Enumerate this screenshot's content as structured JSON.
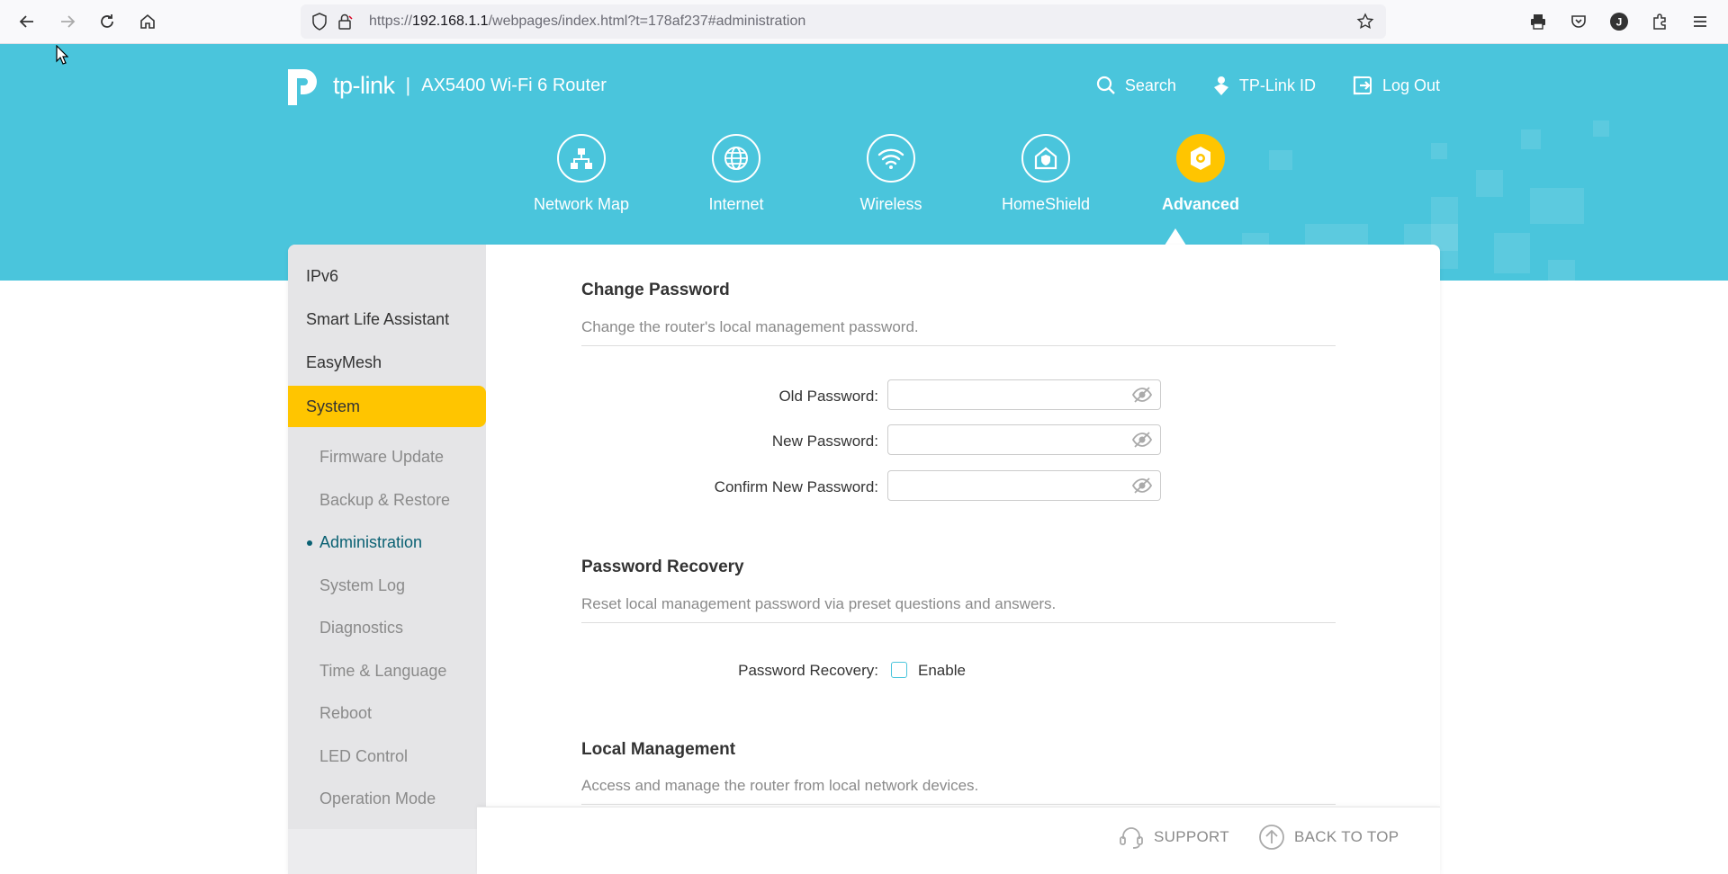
{
  "browser": {
    "url_prefix": "https://",
    "url_host": "192.168.1.1",
    "url_rest": "/webpages/index.html?t=178af237#administration"
  },
  "header": {
    "brand": "tp-link",
    "model": "AX5400 Wi-Fi 6 Router",
    "links": [
      {
        "label": "Search",
        "icon": "search-icon"
      },
      {
        "label": "TP-Link ID",
        "icon": "tplink-id-icon"
      },
      {
        "label": "Log Out",
        "icon": "logout-icon"
      }
    ]
  },
  "nav": [
    {
      "label": "Network Map",
      "icon": "network-map-icon",
      "active": false
    },
    {
      "label": "Internet",
      "icon": "globe-icon",
      "active": false
    },
    {
      "label": "Wireless",
      "icon": "wifi-icon",
      "active": false
    },
    {
      "label": "HomeShield",
      "icon": "homeshield-icon",
      "active": false
    },
    {
      "label": "Advanced",
      "icon": "gear-icon",
      "active": true
    }
  ],
  "sidebar": {
    "top_items": [
      "IPv6",
      "Smart Life Assistant",
      "EasyMesh"
    ],
    "active_section": "System",
    "sub_items": [
      "Firmware Update",
      "Backup & Restore",
      "Administration",
      "System Log",
      "Diagnostics",
      "Time & Language",
      "Reboot",
      "LED Control",
      "Operation Mode"
    ],
    "current_sub": "Administration"
  },
  "sections": {
    "change_password": {
      "title": "Change Password",
      "desc": "Change the router's local management password.",
      "old_label": "Old Password:",
      "new_label": "New Password:",
      "confirm_label": "Confirm New Password:",
      "old_value": "",
      "new_value": "",
      "confirm_value": ""
    },
    "password_recovery": {
      "title": "Password Recovery",
      "desc": "Reset local management password via preset questions and answers.",
      "label": "Password Recovery:",
      "checkbox_label": "Enable",
      "enabled": false
    },
    "local_management": {
      "title": "Local Management",
      "desc": "Access and manage the router from local network devices."
    }
  },
  "footer": {
    "support": "SUPPORT",
    "back_to_top": "BACK TO TOP"
  },
  "colors": {
    "banner": "#4ac5dc",
    "accent": "#ffc500",
    "current_link": "#0a6173"
  }
}
